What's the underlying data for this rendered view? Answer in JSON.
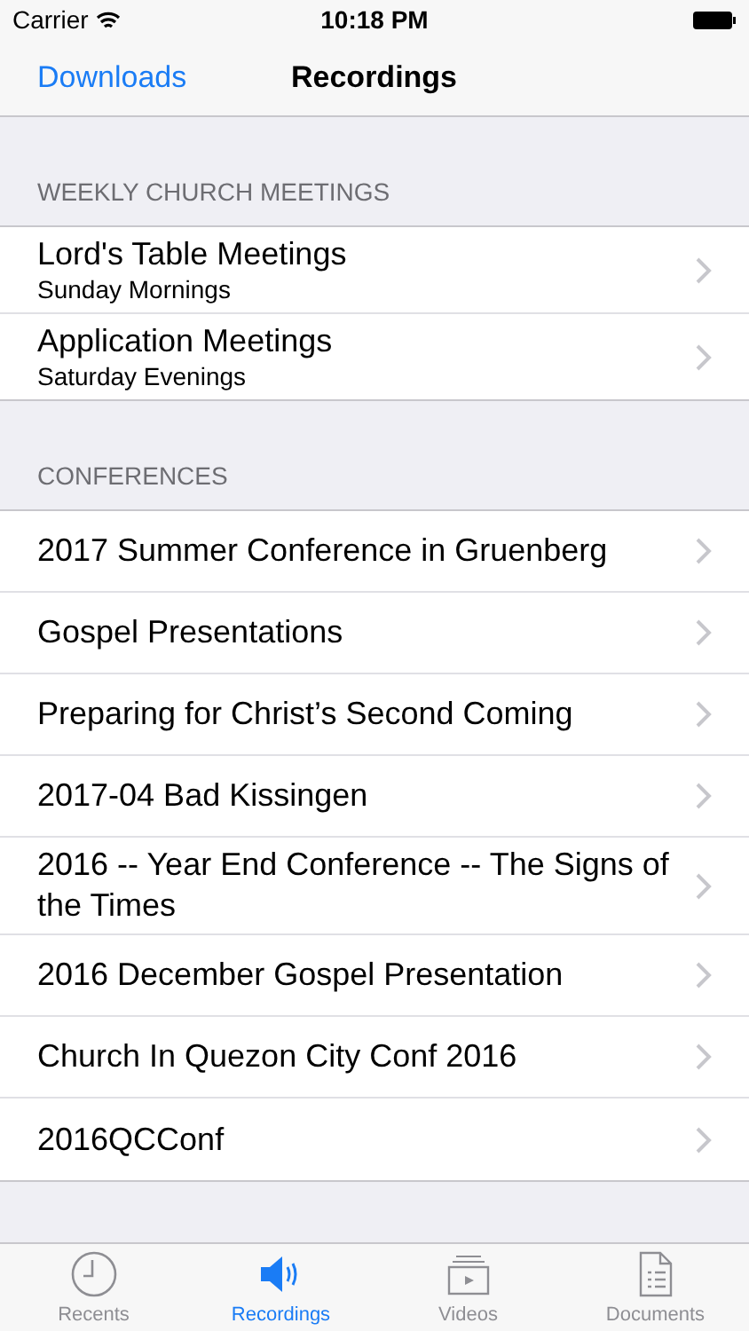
{
  "status_bar": {
    "carrier": "Carrier",
    "time": "10:18 PM"
  },
  "nav": {
    "back": "Downloads",
    "title": "Recordings"
  },
  "sections": [
    {
      "header": "WEEKLY CHURCH MEETINGS",
      "rows": [
        {
          "title": "Lord's Table Meetings",
          "subtitle": "Sunday Mornings"
        },
        {
          "title": "Application Meetings",
          "subtitle": "Saturday Evenings"
        }
      ]
    },
    {
      "header": "CONFERENCES",
      "rows": [
        {
          "title": "2017 Summer Conference in Gruenberg"
        },
        {
          "title": "Gospel Presentations"
        },
        {
          "title": "Preparing for Christ’s Second Coming"
        },
        {
          "title": "2017-04 Bad Kissingen"
        },
        {
          "title": "2016 -- Year End Conference  --  The Signs of the Times"
        },
        {
          "title": "2016 December Gospel Presentation"
        },
        {
          "title": "Church In Quezon City Conf 2016"
        },
        {
          "title": "2016QCConf"
        }
      ]
    }
  ],
  "tabs": [
    {
      "kind": "clock",
      "label": "Recents",
      "selected": false
    },
    {
      "kind": "speaker",
      "label": "Recordings",
      "selected": true
    },
    {
      "kind": "video",
      "label": "Videos",
      "selected": false
    },
    {
      "kind": "document",
      "label": "Documents",
      "selected": false
    }
  ]
}
